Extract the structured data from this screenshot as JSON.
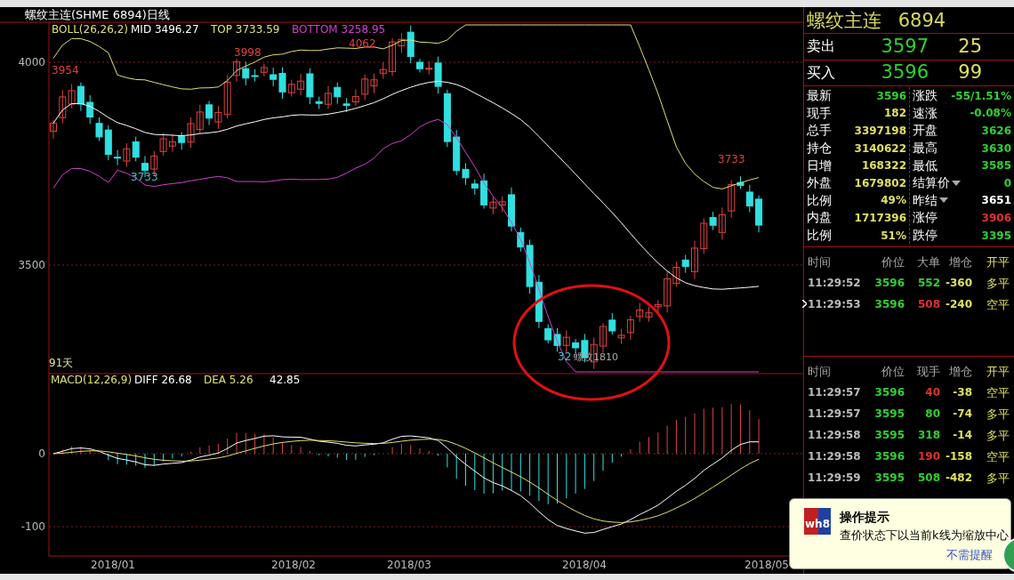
{
  "chart": {
    "title": "螺纹主连(SHME 6894)日线",
    "boll_legend": [
      {
        "text": "BOLL(26,26,2)",
        "color": "#e0e070"
      },
      {
        "text": "MID 3496.27",
        "color": "#ffffff"
      },
      {
        "text": "TOP 3733.59",
        "color": "#e0e070"
      },
      {
        "text": "BOTTOM 3258.95",
        "color": "#d040d0"
      }
    ],
    "price_axis": [
      "4000",
      "3500"
    ],
    "price_labels": [
      {
        "text": "3954",
        "color": "#e04040"
      },
      {
        "text": "3998",
        "color": "#e04040"
      },
      {
        "text": "4062",
        "color": "#e04040"
      },
      {
        "text": "3733",
        "color": "#40c0d0"
      },
      {
        "text": "3733",
        "color": "#e04040"
      }
    ],
    "low_label": "32",
    "overlay_text": "螺纹1810",
    "days_label": "91天",
    "macd_legend": [
      {
        "text": "MACD(12,26,9)",
        "color": "#e0e070"
      },
      {
        "text": "DIFF 26.68",
        "color": "#ffffff"
      },
      {
        "text": "DEA 5.26",
        "color": "#e0e070"
      },
      {
        "text": "42.85",
        "color": "#ffffff"
      }
    ],
    "macd_axis": [
      "0",
      "-100"
    ],
    "dates": [
      "2018/01",
      "2018/02",
      "2018/03",
      "2018/04",
      "2018/05"
    ]
  },
  "quote": {
    "name": "螺纹主连",
    "code": "6894",
    "book": [
      {
        "label": "卖出",
        "price": "3597",
        "volume": "25"
      },
      {
        "label": "买入",
        "price": "3596",
        "volume": "99"
      }
    ],
    "stats_left": [
      {
        "label": "最新",
        "value": "3596",
        "color": "#30d030"
      },
      {
        "label": "现手",
        "value": "182",
        "color": "#e0e060"
      },
      {
        "label": "总手",
        "value": "3397198",
        "color": "#e0e060"
      },
      {
        "label": "持仓",
        "value": "3140622",
        "color": "#e0e060"
      },
      {
        "label": "日增",
        "value": "168322",
        "color": "#e0e060"
      },
      {
        "label": "外盘",
        "value": "1679802",
        "color": "#e0e060"
      },
      {
        "label": "比例",
        "value": "49%",
        "color": "#e0e060"
      },
      {
        "label": "内盘",
        "value": "1717396",
        "color": "#e0e060"
      },
      {
        "label": "比例",
        "value": "51%",
        "color": "#e0e060"
      }
    ],
    "stats_right": [
      {
        "label": "涨跌",
        "value": "-55/1.51%",
        "color": "#30d030"
      },
      {
        "label": "速涨",
        "value": "-0.08%",
        "color": "#30d030"
      },
      {
        "label": "开盘",
        "value": "3626",
        "color": "#30d030"
      },
      {
        "label": "最高",
        "value": "3630",
        "color": "#30d030"
      },
      {
        "label": "最低",
        "value": "3585",
        "color": "#30d030"
      },
      {
        "label": "结算价",
        "value": "0",
        "color": "#30d030",
        "dropdown": true
      },
      {
        "label": "昨结",
        "value": "3651",
        "color": "#ffffff",
        "dropdown": true
      },
      {
        "label": "涨停",
        "value": "3906",
        "color": "#e03030"
      },
      {
        "label": "跌停",
        "value": "3395",
        "color": "#30d030"
      }
    ]
  },
  "big_orders": {
    "columns": [
      "时间",
      "价位",
      "大单",
      "增仓",
      "开平"
    ],
    "rows": [
      {
        "time": "11:29:52",
        "price": "3596",
        "volume": "552",
        "color": "#30d030",
        "change": "-360",
        "action": "多平",
        "selected": false
      },
      {
        "time": "11:29:53",
        "price": "3596",
        "volume": "508",
        "color": "#e03030",
        "change": "-240",
        "action": "空平",
        "selected": true
      }
    ]
  },
  "ticks": {
    "columns": [
      "时间",
      "价位",
      "现手",
      "增仓",
      "开平"
    ],
    "rows": [
      {
        "time": "11:29:57",
        "price": "3596",
        "volume": "40",
        "color": "#e03030",
        "change": "-38",
        "action": "空平"
      },
      {
        "time": "11:29:57",
        "price": "3595",
        "volume": "80",
        "color": "#30d030",
        "change": "-74",
        "action": "多平"
      },
      {
        "time": "11:29:58",
        "price": "3595",
        "volume": "318",
        "color": "#30d030",
        "change": "-14",
        "action": "多平"
      },
      {
        "time": "11:29:58",
        "price": "3596",
        "volume": "190",
        "color": "#e03030",
        "change": "-158",
        "action": "空平"
      },
      {
        "time": "11:29:59",
        "price": "3595",
        "volume": "508",
        "color": "#30d030",
        "change": "-482",
        "action": "多平"
      }
    ]
  },
  "popup": {
    "logo": "wh8",
    "title": "操作提示",
    "message": "查价状态下以当前k线为缩放中心",
    "link": "不需提醒"
  }
}
